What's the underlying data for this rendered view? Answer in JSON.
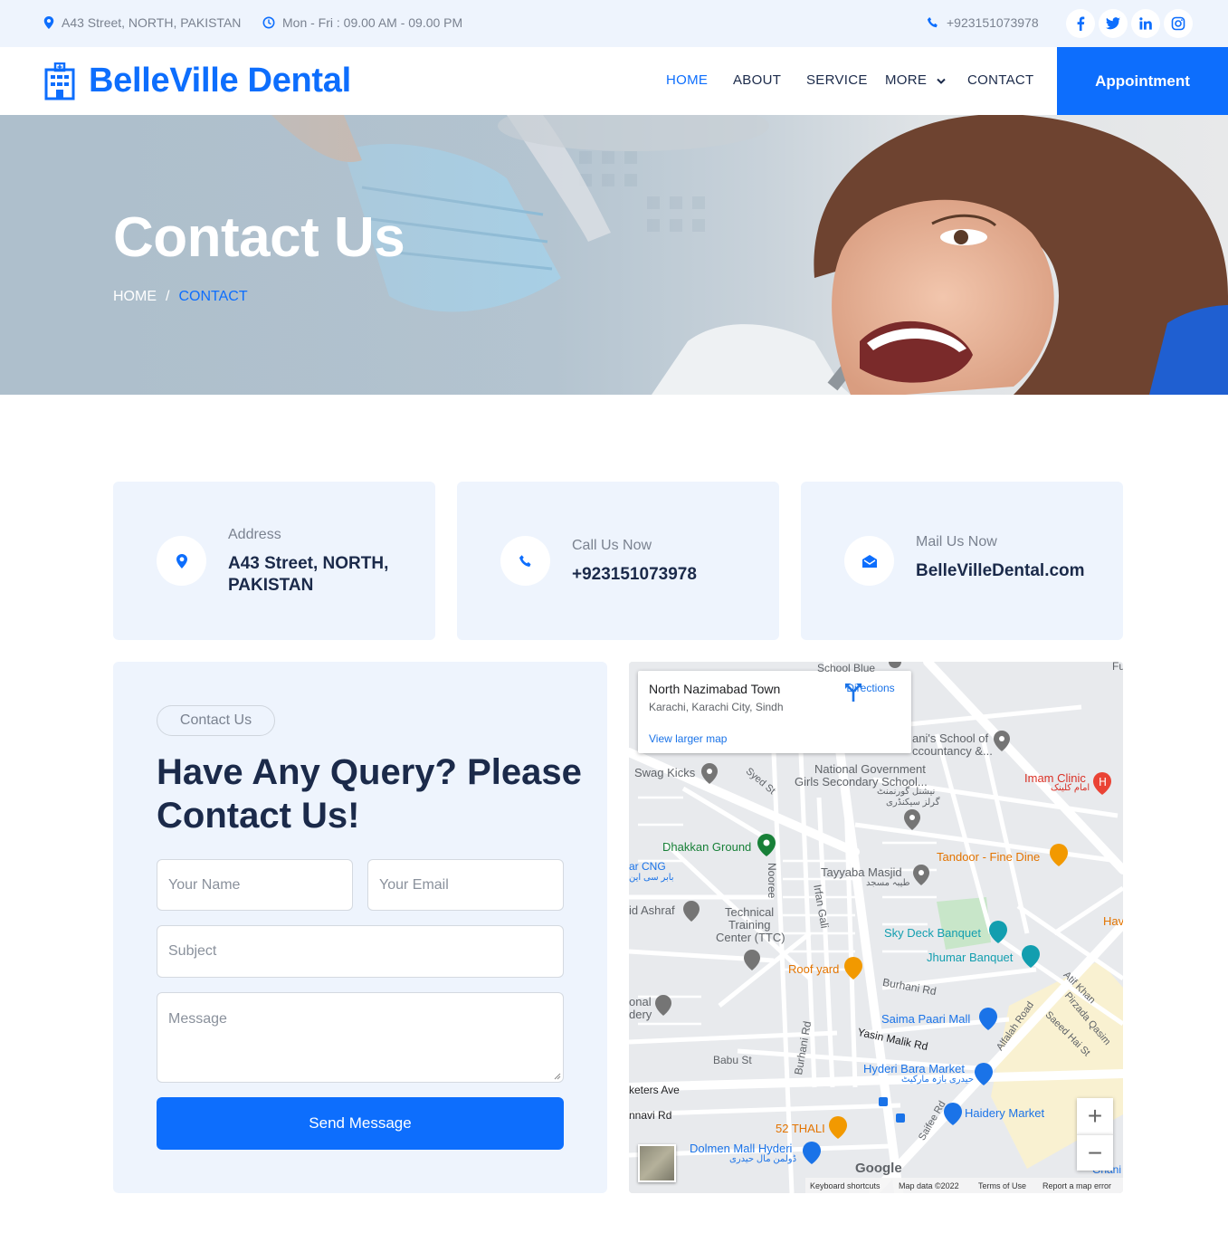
{
  "topbar": {
    "address": "A43 Street, NORTH, PAKISTAN",
    "hours": "Mon - Fri : 09.00 AM - 09.00 PM",
    "phone": "+923151073978",
    "social": [
      "facebook-icon",
      "twitter-icon",
      "linkedin-icon",
      "instagram-icon"
    ]
  },
  "nav": {
    "brand": "BelleVille Dental",
    "items": [
      "HOME",
      "ABOUT",
      "SERVICE",
      "MORE",
      "CONTACT"
    ],
    "active": "HOME",
    "appointment": "Appointment"
  },
  "hero": {
    "title": "Contact Us",
    "breadcrumb_home": "HOME",
    "breadcrumb_sep": "/",
    "breadcrumb_current": "CONTACT"
  },
  "info": {
    "address_label": "Address",
    "address_line1": "A43 Street, NORTH,",
    "address_line2": "PAKISTAN",
    "call_label": "Call Us Now",
    "call_value": "+923151073978",
    "mail_label": "Mail Us Now",
    "mail_value": "BelleVilleDental.com"
  },
  "form": {
    "tag": "Contact Us",
    "title": "Have Any Query? Please Contact Us!",
    "name_placeholder": "Your Name",
    "email_placeholder": "Your Email",
    "subject_placeholder": "Subject",
    "message_placeholder": "Message",
    "submit": "Send Message"
  },
  "map": {
    "place_title": "North Nazimabad Town",
    "place_sub": "Karachi, Karachi City, Sindh",
    "larger_map": "View larger map",
    "directions": "Directions",
    "labels": {
      "school_blue": "School Blue",
      "anis_school": "ani's School of",
      "anis_school2": "ccountancy &...",
      "imam_clinic": "Imam Clinic",
      "imam_urdu": "امام کلینک",
      "swag_kicks": "Swag Kicks",
      "syed_st": "Syed St",
      "ngs_school": "National Government",
      "ngs_school2": "Girls Secondary School...",
      "ngs_urdu1": "نیشنل گورنمنٹ",
      "ngs_urdu2": "گرلز سیکنڈری",
      "dhakkan": "Dhakkan Ground",
      "tandoor": "Tandoor - Fine Dine",
      "ar_cng": "ar CNG",
      "ar_cng_urdu": "بابر سی این",
      "tayyaba": "Tayyaba Masjid",
      "tayyaba_urdu": "طیبہ مسجد",
      "noorani": "Nooree",
      "irfan": "Irfan Gali",
      "id_ashraf": "id Ashraf",
      "ttc1": "Technical",
      "ttc2": "Training",
      "ttc3": "Center (TTC)",
      "sky_deck": "Sky Deck Banquet",
      "jhumar": "Jhumar Banquet",
      "hav": "Hav",
      "roof_yard": "Roof yard",
      "atif": "Atif Khan",
      "burhani_rd": "Burhani Rd",
      "onal": "onal",
      "dery": "dery",
      "saima": "Saima Paari Mall",
      "pirzada": "Pirzada Qasim",
      "saeed": "Saeed Hai St",
      "yasin": "Yasin Malik Rd",
      "alfalah": "Alfalah Road",
      "babu": "Babu St",
      "burhani_rd2": "Burhani Rd",
      "hyderi": "Hyderi Bara Market",
      "hyderi_urdu": "حیدری بازہ مارکیٹ",
      "keters": "keters Ave",
      "nnavi": "nnavi Rd",
      "haidery": "Haidery Market",
      "saifee": "Saifee Rd",
      "thali": "52 THALI",
      "dolmen": "Dolmen Mall Hyderi",
      "dolmen_urdu": "ڈولمن مال حیدری",
      "ghani": "Ghani",
      "fu": "Fu"
    },
    "zoom_in": "+",
    "zoom_out": "−",
    "google": "Google",
    "footer": [
      "Keyboard shortcuts",
      "Map data ©2022",
      "Terms of Use",
      "Report a map error"
    ]
  },
  "colors": {
    "primary": "#0d6efd",
    "dark": "#1b2a4a",
    "light_bg": "#eef4fd",
    "muted": "#7a8290"
  }
}
